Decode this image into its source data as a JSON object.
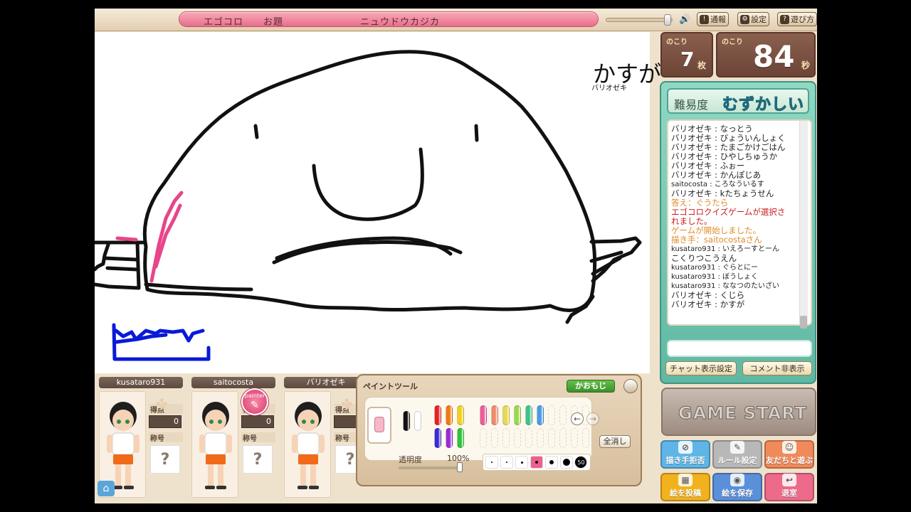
{
  "header": {
    "game_name": "エゴコロ",
    "topic_label": "お題",
    "topic": "ニュウドウカジカ",
    "buttons": [
      {
        "label": "通報",
        "icon": "report-icon"
      },
      {
        "label": "設定",
        "icon": "settings-icon"
      },
      {
        "label": "遊び方",
        "icon": "help-icon"
      }
    ]
  },
  "canvas": {
    "overlay_text": "かすが",
    "overlay_user": "バリオゼキ"
  },
  "status": {
    "remaining_cards_label": "のこり",
    "remaining_cards": "7",
    "remaining_cards_unit": "枚",
    "remaining_time_label": "のこり",
    "remaining_time": "84",
    "remaining_time_unit": "秒"
  },
  "difficulty": {
    "label": "難易度",
    "value": "むずかしい"
  },
  "chat": {
    "messages": [
      {
        "text": "バリオゼキ : なっとう",
        "style": "normal"
      },
      {
        "text": "バリオゼキ : びょういんしょく",
        "style": "normal"
      },
      {
        "text": "バリオゼキ : たまごかけごはん",
        "style": "normal"
      },
      {
        "text": "バリオゼキ : ひやしちゅうか",
        "style": "normal"
      },
      {
        "text": "バリオゼキ : ふぉー",
        "style": "normal"
      },
      {
        "text": "バリオゼキ : かんぽじあ",
        "style": "normal"
      },
      {
        "text": "saitocosta : ころなういるす",
        "style": "normal"
      },
      {
        "text": "バリオゼキ : kたちょうせん",
        "style": "normal"
      },
      {
        "text": "答え：ぐうたら",
        "style": "orange"
      },
      {
        "text": "エゴコロクイズゲームが選択さ",
        "style": "red"
      },
      {
        "text": "れました。",
        "style": "red"
      },
      {
        "text": "ゲームが開始しました。",
        "style": "orange"
      },
      {
        "text": "描き手：saitocostaさん",
        "style": "orange"
      },
      {
        "text": "kusataro931 : いえろーすとーん",
        "style": "normal"
      },
      {
        "text": "こくりつこうえん",
        "style": "normal"
      },
      {
        "text": "kusataro931 : ぐらとにー",
        "style": "normal"
      },
      {
        "text": "kusataro931 : ぼうしょく",
        "style": "normal"
      },
      {
        "text": "kusataro931 : ななつのたいざい",
        "style": "normal"
      },
      {
        "text": "バリオゼキ : くじら",
        "style": "normal"
      },
      {
        "text": "バリオゼキ : かすが",
        "style": "normal"
      }
    ],
    "input_value": "",
    "settings_button": "チャット表示設定",
    "hide_comments_button": "コメント非表示"
  },
  "game_start": "GAME START",
  "side_buttons": [
    {
      "label": "描き手拒否",
      "color": "#5fb6e6",
      "icon": "refuse-icon"
    },
    {
      "label": "ルール設定",
      "color": "#b8b8b8",
      "icon": "wrench-icon"
    },
    {
      "label": "友だちと遊ぶ",
      "color": "#f08a5a",
      "icon": "friends-icon"
    },
    {
      "label": "絵を投稿",
      "color": "#f2b21e",
      "icon": "post-image-icon"
    },
    {
      "label": "絵を保存",
      "color": "#5a8fd9",
      "icon": "camera-icon"
    },
    {
      "label": "退室",
      "color": "#ee6a8a",
      "icon": "exit-icon"
    }
  ],
  "players": [
    {
      "name": "kusataro931",
      "score_label": "得点",
      "score": "0",
      "title_label": "称号",
      "title": "?",
      "painter": false
    },
    {
      "name": "saitocosta",
      "score_label": "得点",
      "score": "0",
      "title_label": "称号",
      "title": "?",
      "painter": true,
      "painter_badge": "painter"
    },
    {
      "name": "バリオゼキ",
      "score_label": "得点",
      "score": "",
      "title_label": "称号",
      "title": "?",
      "painter": false
    }
  ],
  "paint_tool": {
    "title": "ペイントツール",
    "kaomoji_button": "かおもじ",
    "opacity_label": "透明度",
    "opacity_value": "100%",
    "clear_button": "全消し",
    "size_max_label": "50",
    "colors_dark": [
      "#111111",
      "#ffffff"
    ],
    "colors_primary": [
      "#e82020",
      "#f07a10",
      "#f2d01a",
      "#3a2ad8",
      "#9a2ad8",
      "#2cc43a"
    ],
    "colors_light": [
      "#ee5a9a",
      "#f08a6a",
      "#e8d84a",
      "#9ad84a",
      "#3ac48a",
      "#4a9ae8"
    ]
  },
  "colors": {
    "accent_pink": "#e76f8a",
    "panel_teal": "#5fb8a3",
    "drawing_black": "#111111",
    "drawing_pink": "#e8458a",
    "drawing_blue": "#0a1ad8"
  }
}
